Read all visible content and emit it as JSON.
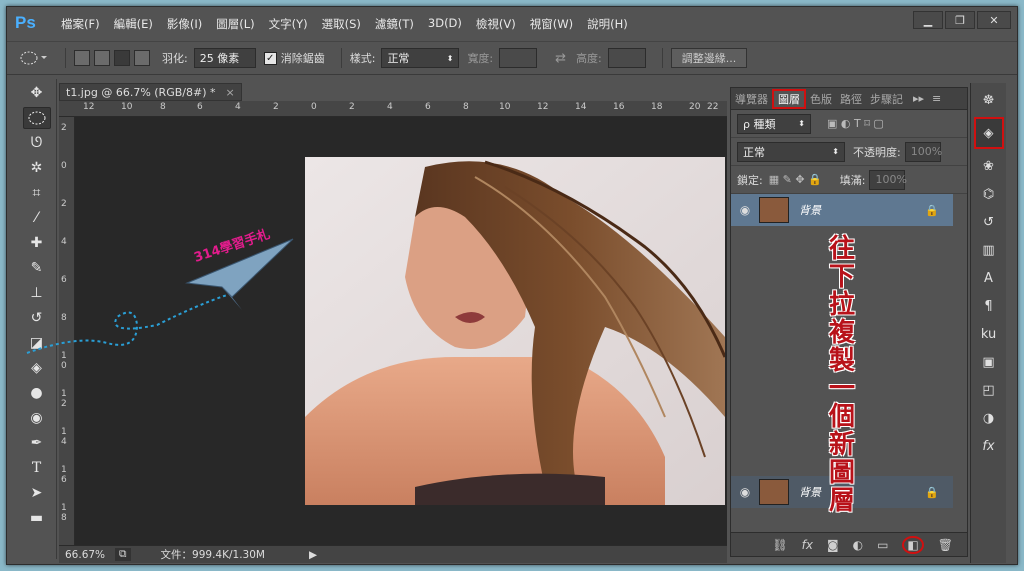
{
  "app": {
    "logo": "Ps"
  },
  "menu": [
    "檔案(F)",
    "編輯(E)",
    "影像(I)",
    "圖層(L)",
    "文字(Y)",
    "選取(S)",
    "濾鏡(T)",
    "3D(D)",
    "檢視(V)",
    "視窗(W)",
    "說明(H)"
  ],
  "window_buttons": [
    "▁",
    "❐",
    "✕"
  ],
  "options": {
    "feather_label": "羽化:",
    "feather_value": "25 像素",
    "antialias_label": "消除鋸齒",
    "antialias_checked": "✓",
    "style_label": "樣式:",
    "style_value": "正常",
    "width_label": "寬度:",
    "height_label": "高度:",
    "refine_button": "調整邊緣..."
  },
  "document": {
    "tab_title": "t1.jpg @ 66.7% (RGB/8#) *",
    "close": "×",
    "ruler_h": [
      "12",
      "10",
      "8",
      "6",
      "4",
      "2",
      "0",
      "2",
      "4",
      "6",
      "8",
      "10",
      "12",
      "14",
      "16",
      "18",
      "20",
      "22"
    ],
    "ruler_v": [
      "2",
      "0",
      "2",
      "4",
      "6",
      "8",
      "1 0",
      "1 2",
      "1 4",
      "1 6",
      "1 8"
    ],
    "zoom": "66.67%",
    "file_info": "文件：999.4K/1.30M"
  },
  "watermark": "314學習手札",
  "panel": {
    "tabs": [
      "導覽器",
      "圖層",
      "色版",
      "路徑",
      "步驟記"
    ],
    "active_tab": "圖層",
    "filter_label": "ρ 種類",
    "blend_mode": "正常",
    "opacity_label": "不透明度:",
    "opacity_value": "100%",
    "lock_label": "鎖定:",
    "fill_label": "填滿:",
    "fill_value": "100%",
    "layers": [
      {
        "name": "背景"
      },
      {
        "name": "背景"
      }
    ]
  },
  "annotation": "往下拉複製一個新圖層",
  "footer_icons": [
    "link-icon",
    "fx-icon",
    "mask-icon",
    "adjustment-icon",
    "folder-icon",
    "new-layer-icon",
    "trash-icon"
  ],
  "colors": {
    "highlight": "#d01010",
    "annotation": "#b8121a",
    "watermark": "#e21c8c",
    "layer_selected": "#5f7891"
  }
}
